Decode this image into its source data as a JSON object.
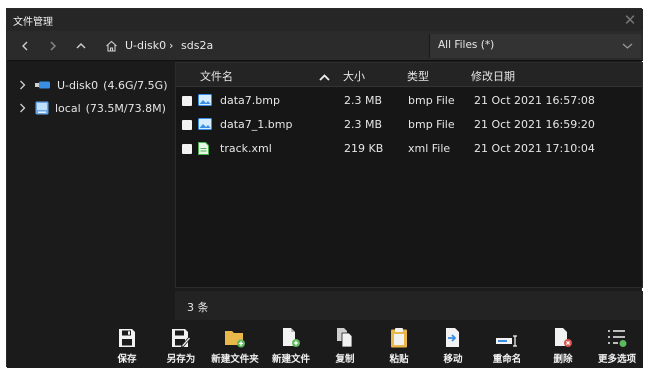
{
  "window": {
    "title": "文件管理",
    "close_icon": "close-icon"
  },
  "navbar": {
    "path": [
      {
        "label": "U-disk0"
      },
      {
        "label": "sds2a"
      }
    ],
    "filter": {
      "selected": "All Files (*)"
    }
  },
  "tree": {
    "items": [
      {
        "label": "U-disk0",
        "size": "(4.6G/7.5G)",
        "icon": "usb-drive-icon"
      },
      {
        "label": "local",
        "size": "(73.5M/73.8M)",
        "icon": "local-drive-icon"
      }
    ]
  },
  "list": {
    "columns": {
      "name": "文件名",
      "size": "大小",
      "type": "类型",
      "date": "修改日期"
    },
    "rows": [
      {
        "name": "data7.bmp",
        "size": "2.3 MB",
        "type": "bmp File",
        "date": "21 Oct 2021 16:57:08",
        "icon": "image-file-icon"
      },
      {
        "name": "data7_1.bmp",
        "size": "2.3 MB",
        "type": "bmp File",
        "date": "21 Oct 2021 16:59:20",
        "icon": "image-file-icon"
      },
      {
        "name": "track.xml",
        "size": "219 KB",
        "type": "xml File",
        "date": "21 Oct 2021 17:10:04",
        "icon": "xml-file-icon"
      }
    ]
  },
  "status": {
    "count": "3 条"
  },
  "toolbar": {
    "save": "保存",
    "save_as": "另存为",
    "new_folder": "新建文件夹",
    "new_file": "新建文件",
    "copy": "复制",
    "paste": "粘贴",
    "move": "移动",
    "rename": "重命名",
    "delete": "删除",
    "more": "更多选项"
  },
  "colors": {
    "accent_green": "#5cb85c",
    "delete_red": "#d9534f",
    "folder_yellow": "#e8b84a",
    "usb_blue": "#3a8ee6"
  }
}
